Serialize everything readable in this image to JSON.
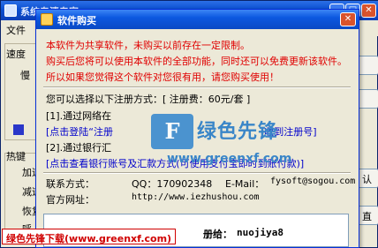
{
  "main_window": {
    "title": "系统专清专家",
    "menu": [
      "文件",
      "设"
    ],
    "side_labels": [
      "速度",
      "慢",
      "热键",
      "加速",
      "减速",
      "恢复",
      "呼"
    ],
    "right_labels": [
      "认",
      "直"
    ]
  },
  "dialog": {
    "title": "软件购买",
    "intro_lines": [
      "本软件为共享软件，未购买以前存在一定限制。",
      "购买后您将可以使用本软件的全部功能，同时还可以免费更新该软件。",
      "所以如果您觉得这个软件对您很有用，请您购买使用！"
    ],
    "register_prompt": "您可以选择以下注册方式：[ 注册费：60元/套 ]",
    "method1_title": "[1].通过网络在",
    "method1_link": "[点击登陆“注册",
    "method1_link_tail": "J收到注册号]",
    "method2_title": "[2].通过银行汇",
    "method2_link": "[点击查看银行账号及汇款方式(可使用支付宝即时到账付款)]",
    "contact_label": "联系方式：",
    "qq": "QQ：170902348",
    "email_label": "E-Mail：",
    "email": "fysoft@sogou.com",
    "site_label": "官方网址：",
    "site": "http://www.iezhushou.com",
    "code_label": "册给：",
    "code_value": "nuojiya8"
  },
  "watermark": {
    "logo_letters": "F",
    "chinese": "绿色先锋",
    "url": "www.greenxf.com"
  },
  "stamp_text": "绿色先锋下载(www.greenxf.com)"
}
